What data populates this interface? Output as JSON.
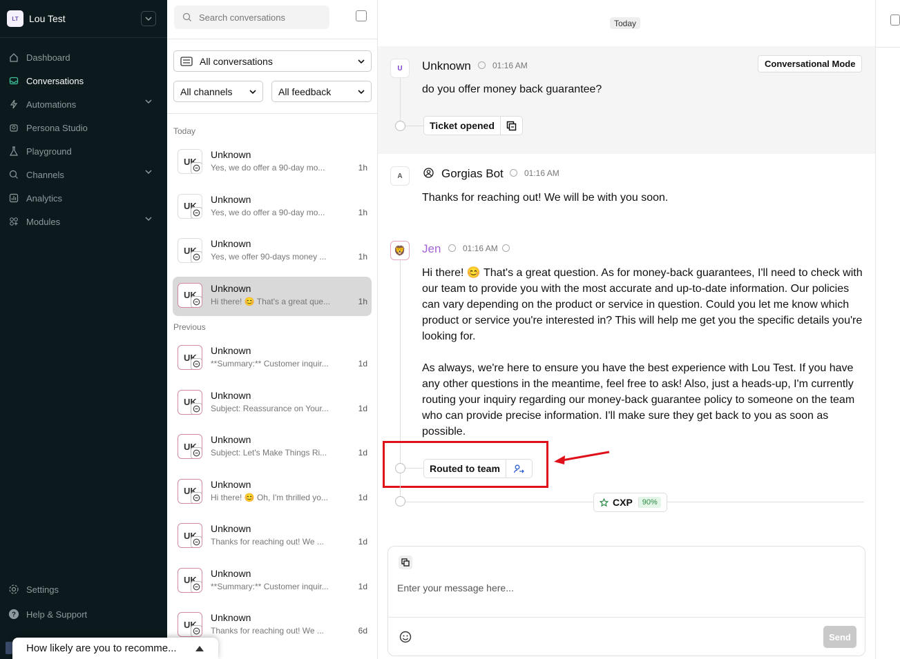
{
  "workspace": {
    "initials": "LT",
    "name": "Lou Test"
  },
  "nav": [
    {
      "label": "Dashboard",
      "icon": "home-icon"
    },
    {
      "label": "Conversations",
      "icon": "inbox-icon",
      "active": true
    },
    {
      "label": "Automations",
      "icon": "bolt-icon",
      "expandable": true
    },
    {
      "label": "Persona Studio",
      "icon": "persona-icon"
    },
    {
      "label": "Playground",
      "icon": "flask-icon"
    },
    {
      "label": "Channels",
      "icon": "channels-icon",
      "expandable": true
    },
    {
      "label": "Analytics",
      "icon": "analytics-icon"
    },
    {
      "label": "Modules",
      "icon": "modules-icon",
      "expandable": true
    }
  ],
  "nav_bottom": [
    {
      "label": "Settings",
      "icon": "gear-icon"
    },
    {
      "label": "Help & Support",
      "icon": "help-icon"
    }
  ],
  "survey": {
    "text": "How likely are you to recomme..."
  },
  "list": {
    "search_placeholder": "Search conversations",
    "filter_conversations": "All conversations",
    "filter_channels": "All channels",
    "filter_feedback": "All feedback",
    "section_today": "Today",
    "section_previous": "Previous",
    "today": [
      {
        "initials": "UK",
        "name": "Unknown",
        "preview": "Yes, we do offer a 90-day mo...",
        "time": "1h"
      },
      {
        "initials": "UK",
        "name": "Unknown",
        "preview": "Yes, we do offer a 90-day mo...",
        "time": "1h"
      },
      {
        "initials": "UK",
        "name": "Unknown",
        "preview": "Yes, we offer 90-days money ...",
        "time": "1h"
      },
      {
        "initials": "UK",
        "name": "Unknown",
        "preview": "Hi there! 😊 That's a great que...",
        "time": "1h",
        "selected": true
      }
    ],
    "previous": [
      {
        "initials": "UK",
        "name": "Unknown",
        "preview": "**Summary:** Customer inquir...",
        "time": "1d"
      },
      {
        "initials": "UK",
        "name": "Unknown",
        "preview": "Subject: Reassurance on Your...",
        "time": "1d"
      },
      {
        "initials": "UK",
        "name": "Unknown",
        "preview": "Subject: Let's Make Things Ri...",
        "time": "1d"
      },
      {
        "initials": "UK",
        "name": "Unknown",
        "preview": "Hi there! 😊 Oh, I'm thrilled yo...",
        "time": "1d"
      },
      {
        "initials": "UK",
        "name": "Unknown",
        "preview": "Thanks for reaching out! We ...",
        "time": "1d"
      },
      {
        "initials": "UK",
        "name": "Unknown",
        "preview": "**Summary:** Customer inquir...",
        "time": "1d"
      },
      {
        "initials": "UK",
        "name": "Unknown",
        "preview": "Thanks for reaching out! We ...",
        "time": "6d"
      }
    ]
  },
  "thread": {
    "date_pill": "Today",
    "mode_button": "Conversational Mode",
    "msg1": {
      "avatar": "U",
      "sender": "Unknown",
      "time": "01:16 AM",
      "text": "do you offer money back guarantee?"
    },
    "event1": {
      "label": "Ticket opened",
      "icon": "copy-icon"
    },
    "msg2": {
      "avatar": "A",
      "sender": "Gorgias Bot",
      "time": "01:16 AM",
      "text": "Thanks for reaching out! We will be with you soon."
    },
    "msg3": {
      "avatar": "🦁",
      "sender": "Jen",
      "time": "01:16 AM",
      "para1": "Hi there! 😊 That's a great question. As for money-back guarantees, I'll need to check with our team to provide you with the most accurate and up-to-date information. Our policies can vary depending on the product or service in question. Could you let me know which product or service you're interested in? This will help me get you the specific details you're looking for.",
      "para2": "As always, we're here to ensure you have the best experience with Lou Test. If you have any other questions in the meantime, feel free to ask! Also, just a heads-up, I'm currently routing your inquiry regarding our money-back guarantee policy to someone on the team who can provide precise information. I'll make sure they get back to you as soon as possible."
    },
    "event2": {
      "label": "Routed to team",
      "icon": "user-arrow-icon"
    },
    "cxp": {
      "label": "CXP",
      "value": "90%"
    }
  },
  "composer": {
    "placeholder": "Enter your message here...",
    "send_label": "Send"
  },
  "colors": {
    "sidebar_bg": "#0c1a1d",
    "accent_purple": "#a463d6",
    "highlight_red": "#e0101a",
    "cxp_green": "#2c8a45"
  }
}
